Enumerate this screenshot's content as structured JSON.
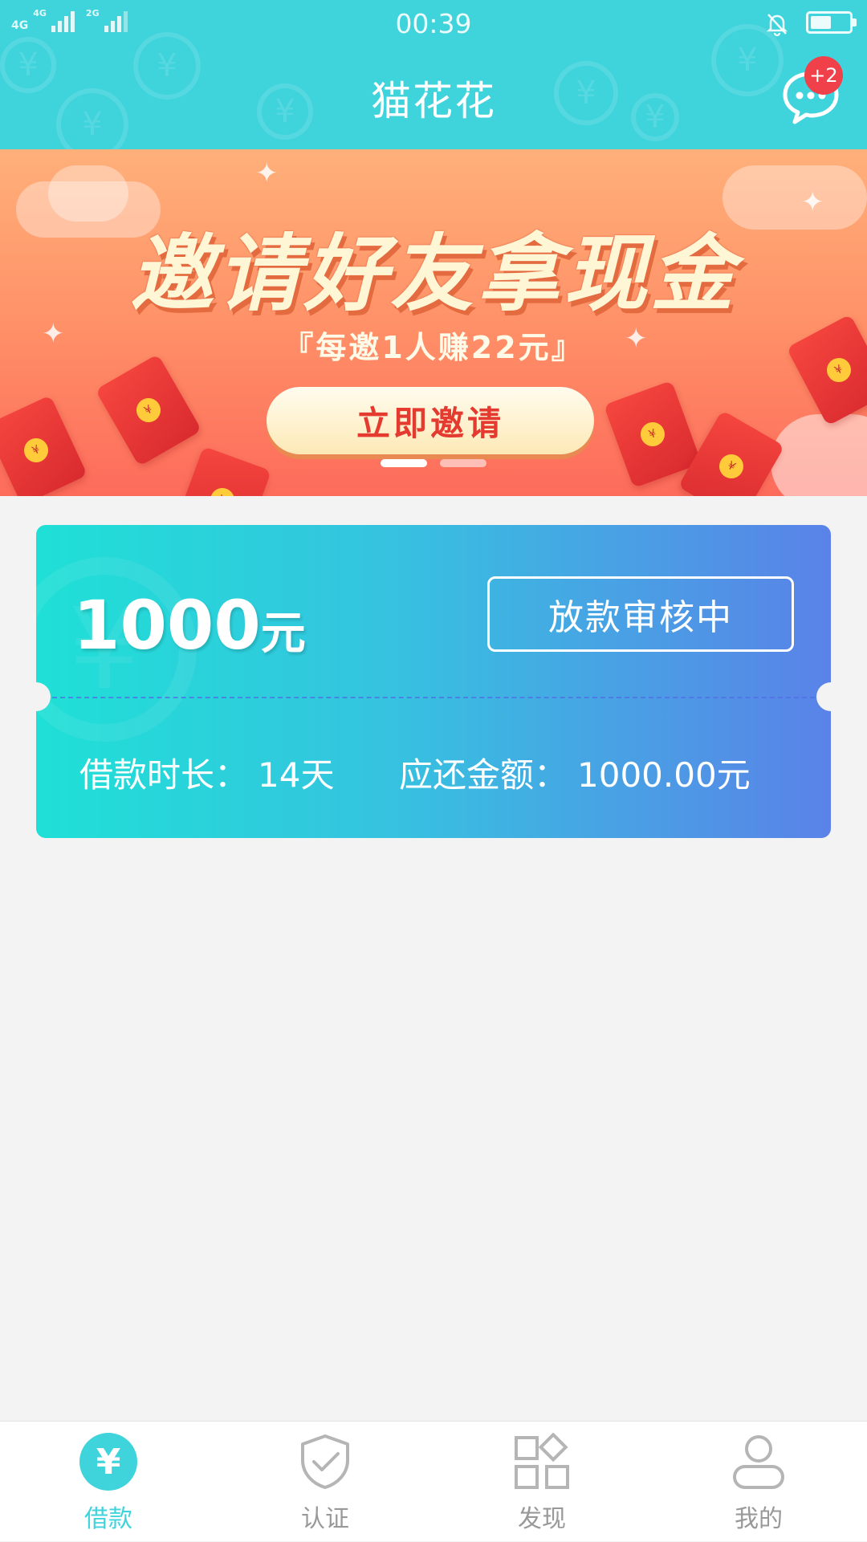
{
  "status_bar": {
    "network_1": "4G",
    "network_2": "4G",
    "network_3": "2G",
    "time": "00:39",
    "battery_level": 0.55
  },
  "header": {
    "title": "猫花花",
    "message_badge": "+2"
  },
  "banner": {
    "headline": "邀请好友拿现金",
    "subline": "『每邀1人赚22元』",
    "button_label": "立即邀请",
    "envelope_mark": "¥",
    "slide_count": 2,
    "active_slide": 0
  },
  "loan_card": {
    "amount": "1000",
    "amount_unit": "元",
    "status_label": "放款审核中",
    "term_label": "借款时长：",
    "term_value": "14天",
    "repay_label": "应还金额：",
    "repay_value": "1000.00元"
  },
  "bottom_nav": {
    "items": [
      {
        "label": "借款",
        "icon": "yuan-icon",
        "active": true,
        "glyph": "¥"
      },
      {
        "label": "认证",
        "icon": "shield-check-icon",
        "active": false
      },
      {
        "label": "发现",
        "icon": "grid-icon",
        "active": false
      },
      {
        "label": "我的",
        "icon": "user-icon",
        "active": false
      }
    ]
  },
  "colors": {
    "accent": "#3fd3dc",
    "badge": "#f0414b",
    "card_start": "#1fe0d6",
    "card_end": "#5a82e8"
  }
}
